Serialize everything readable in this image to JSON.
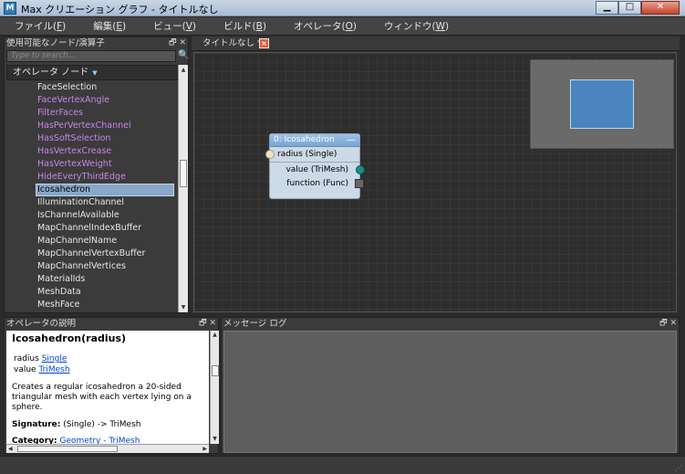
{
  "window": {
    "title": "Max クリエーション グラフ - タイトルなし",
    "app_icon": "max-app-icon",
    "buttons": {
      "minimize": "▁",
      "maximize": "□",
      "close": "✕"
    }
  },
  "menu": [
    {
      "label": "ファイル(",
      "key": "F",
      "tail": ")"
    },
    {
      "label": "編集(",
      "key": "E",
      "tail": ")"
    },
    {
      "label": "ビュー(",
      "key": "V",
      "tail": ")"
    },
    {
      "label": "ビルド(",
      "key": "B",
      "tail": ")"
    },
    {
      "label": "オペレータ(",
      "key": "O",
      "tail": ")"
    },
    {
      "label": "ウィンドウ(",
      "key": "W",
      "tail": ")"
    }
  ],
  "node_panel": {
    "title": "使用可能なノード/演算子",
    "search_placeholder": "Type to search...",
    "category": "オペレータ ノード",
    "items": [
      {
        "label": "FaceSelection",
        "style": "normal"
      },
      {
        "label": "FaceVertexAngle",
        "style": "purple"
      },
      {
        "label": "FilterFaces",
        "style": "purple"
      },
      {
        "label": "HasPerVertexChannel",
        "style": "purple"
      },
      {
        "label": "HasSoftSelection",
        "style": "purple"
      },
      {
        "label": "HasVertexCrease",
        "style": "purple"
      },
      {
        "label": "HasVertexWeight",
        "style": "purple"
      },
      {
        "label": "HideEveryThirdEdge",
        "style": "purple"
      },
      {
        "label": "Icosahedron",
        "style": "selected"
      },
      {
        "label": "IlluminationChannel",
        "style": "normal"
      },
      {
        "label": "IsChannelAvailable",
        "style": "normal"
      },
      {
        "label": "MapChannelIndexBuffer",
        "style": "normal"
      },
      {
        "label": "MapChannelName",
        "style": "normal"
      },
      {
        "label": "MapChannelVertexBuffer",
        "style": "normal"
      },
      {
        "label": "MapChannelVertices",
        "style": "normal"
      },
      {
        "label": "MaterialIds",
        "style": "normal"
      },
      {
        "label": "MeshData",
        "style": "normal"
      },
      {
        "label": "MeshFace",
        "style": "normal"
      }
    ]
  },
  "graph": {
    "tab_label": "タイトルなし *",
    "tab_close": "×",
    "node": {
      "title": "0: Icosahedron",
      "collapse": "—",
      "input": "radius (Single)",
      "outputs": [
        "value (TriMesh)",
        "function (Func)"
      ]
    }
  },
  "description_panel": {
    "title": "オペレータの説明",
    "heading": "Icosahedron(radius)",
    "params": [
      {
        "name": "radius",
        "type": "Single"
      },
      {
        "name": "value",
        "type": "TriMesh"
      }
    ],
    "text": "Creates a regular icosahedron a 20-sided triangular mesh with each vertex lying on a sphere.",
    "signature_label": "Signature:",
    "signature_value": " (Single) -> TriMesh",
    "category_label": "Category:",
    "category_value": "Geometry - TriMesh"
  },
  "log_panel": {
    "title": "メッセージ ログ"
  },
  "panel_buttons": "🗗 ✕"
}
